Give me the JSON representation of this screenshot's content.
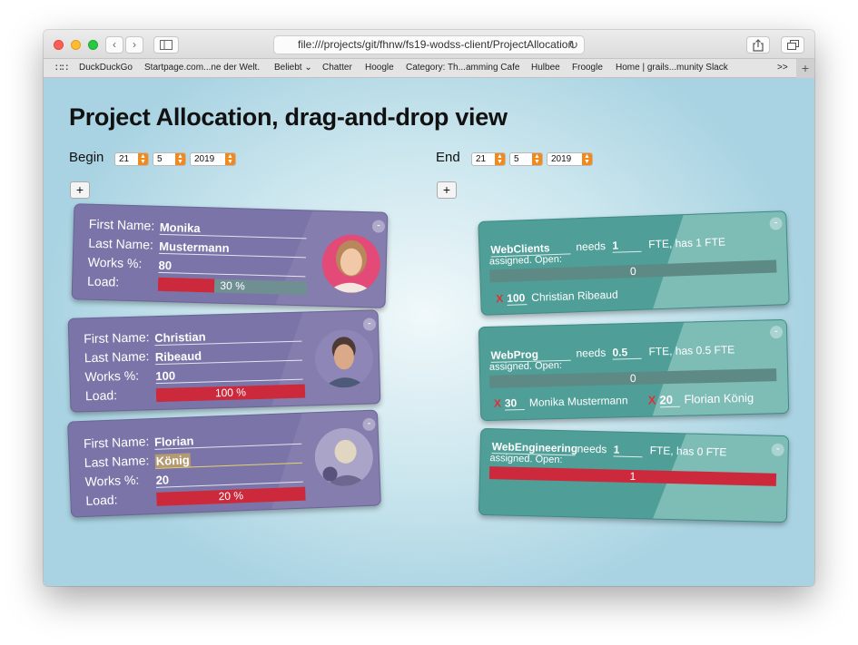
{
  "browser": {
    "address": "file:///projects/git/fhnw/fs19-wodss-client/ProjectAllocation",
    "bookmarks": [
      "DuckDuckGo",
      "Startpage.com...ne der Welt.",
      "Beliebt ⌄",
      "Chatter",
      "Hoogle",
      "Category: Th...amming Cafe",
      "Hulbee",
      "Froogle",
      "Home | grails...munity Slack"
    ],
    "more": ">>",
    "newtab": "+"
  },
  "page": {
    "title": "Project Allocation, drag-and-drop view",
    "begin": {
      "label": "Begin",
      "day": "21",
      "month": "5",
      "year": "2019"
    },
    "end": {
      "label": "End",
      "day": "21",
      "month": "5",
      "year": "2019"
    },
    "add_label": "+",
    "remove_label": "-"
  },
  "labels": {
    "first_name": "First Name:",
    "last_name": "Last Name:",
    "works": "Works %:",
    "load": "Load:",
    "needs": "needs",
    "assigned_open": "assigned. Open:",
    "remove_mark": "X"
  },
  "persons": [
    {
      "first": "Monika",
      "last": "Mustermann",
      "works": "80",
      "load_text": "30 %",
      "load_fraction": 0.375
    },
    {
      "first": "Christian",
      "last": "Ribeaud",
      "works": "100",
      "load_text": "100 %",
      "load_fraction": 1.0
    },
    {
      "first": "Florian",
      "last": "König",
      "works": "20",
      "load_text": "20 %",
      "load_fraction": 1.0
    }
  ],
  "projects": [
    {
      "name": "WebClients",
      "needs": "1",
      "has_text": "FTE, has 1 FTE",
      "open": "0",
      "assignments": [
        {
          "pct": "100",
          "first": "Christian",
          "last": "Ribeaud"
        }
      ]
    },
    {
      "name": "WebProg",
      "needs": "0.5",
      "has_text": "FTE, has 0.5 FTE",
      "open": "0",
      "assignments": [
        {
          "pct": "30",
          "first": "Monika",
          "last": "Mustermann"
        },
        {
          "pct": "20",
          "first": "Florian",
          "last": "König"
        }
      ]
    },
    {
      "name": "WebEngineering",
      "needs": "1",
      "has_text": "FTE, has 0 FTE",
      "open": "1",
      "assignments": []
    }
  ],
  "colors": {
    "person_card": "#7b74a8",
    "project_card": "#4f9f98",
    "load_red": "#cc2a3c",
    "spinner_orange": "#f08a1f"
  }
}
